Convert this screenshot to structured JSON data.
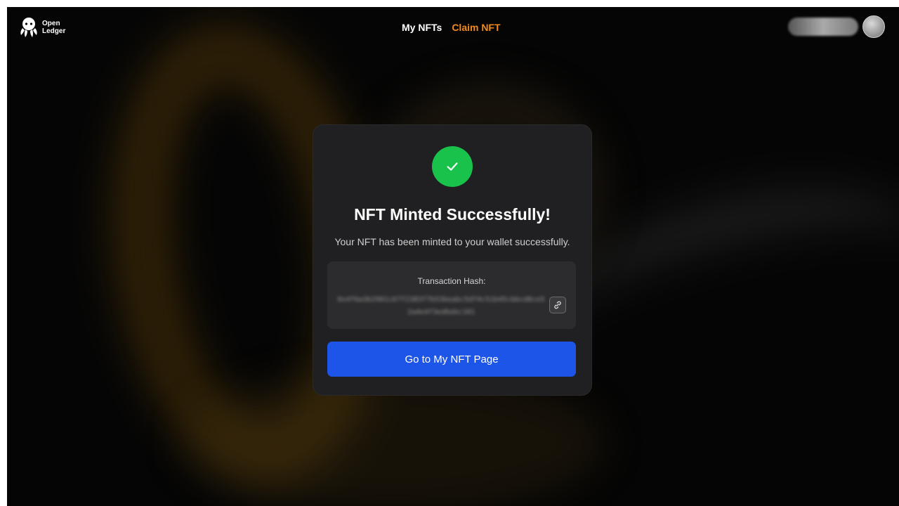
{
  "header": {
    "logo_text_line1": "Open",
    "logo_text_line2": "Ledger",
    "nav": {
      "my_nfts": "My NFTs",
      "claim_nft": "Claim NFT"
    },
    "account": {
      "avatar_icon": "avatar-circle"
    }
  },
  "modal": {
    "status_icon": "check-icon",
    "title": "NFT Minted Successfully!",
    "subtitle": "Your NFT has been minted to your wallet successfully.",
    "hash_label": "Transaction Hash:",
    "hash_value": "0x4f6a3b2901c67f2383f7b53beabc5d74c51b45cbbcd8ce52a4e4f3ed6ebc101",
    "copy_icon": "link-icon",
    "cta_label": "Go to My NFT Page"
  },
  "colors": {
    "accent_orange": "#f28a1b",
    "success_green": "#19c24a",
    "button_blue": "#1d55e8",
    "card_bg": "#202022"
  }
}
